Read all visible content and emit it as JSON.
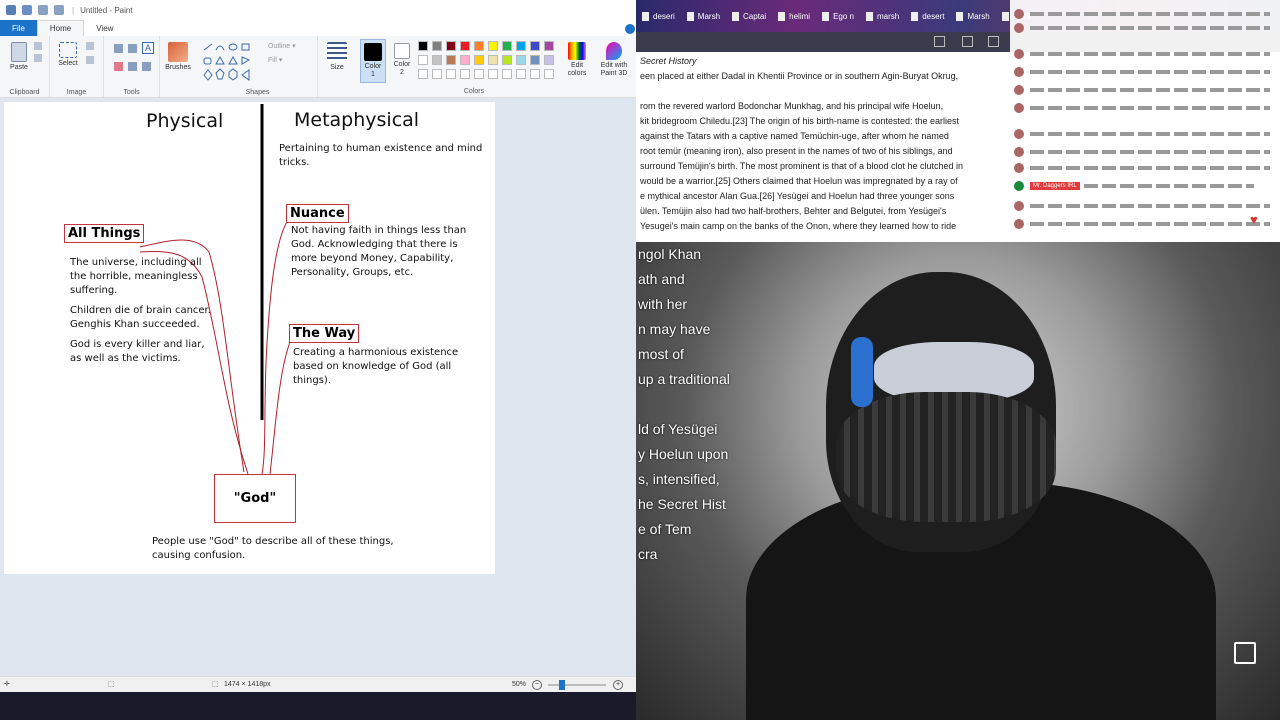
{
  "paint": {
    "title": "Untitled - Paint",
    "tabs": [
      "File",
      "Home",
      "View"
    ],
    "groups": {
      "clipboard": "Clipboard",
      "image": "Image",
      "tools": "Tools",
      "shapes": "Shapes",
      "colors": "Colors"
    },
    "buttons": {
      "paste": "Paste",
      "select": "Select",
      "brushes": "Brushes",
      "outline": "Outline",
      "fill": "Fill",
      "size": "Size",
      "color1_a": "Color",
      "color1_b": "1",
      "color2_a": "Color",
      "color2_b": "2",
      "edit_colors_a": "Edit",
      "edit_colors_b": "colors",
      "paint3d_a": "Edit with",
      "paint3d_b": "Paint 3D"
    },
    "palette": [
      "#000000",
      "#7f7f7f",
      "#880015",
      "#ed1c24",
      "#ff7f27",
      "#fff200",
      "#22b14c",
      "#00a2e8",
      "#3f48cc",
      "#a349a4",
      "#ffffff",
      "#c3c3c3",
      "#b97a57",
      "#ffaec9",
      "#ffc90e",
      "#efe4b0",
      "#b5e61d",
      "#99d9ea",
      "#7092be",
      "#c8bfe7"
    ],
    "status": {
      "dimensions": "1474 × 1418px",
      "zoom": "50%"
    }
  },
  "drawing": {
    "col_physical": "Physical",
    "col_metaphysical": "Metaphysical",
    "metaphysical_desc": [
      "Pertaining to human existence and mind",
      "tricks."
    ],
    "all_things": {
      "label": "All Things",
      "lines": [
        "The universe, including all",
        "the horrible, meaningless",
        "suffering.",
        "",
        "Children die of brain cancer.",
        "Genghis Khan succeeded.",
        "",
        "God is every killer and liar,",
        "as well as the victims."
      ]
    },
    "nuance": {
      "label": "Nuance",
      "lines": [
        "Not having faith in things less than",
        "God. Acknowledging that there is",
        "more beyond Money, Capability,",
        "Personality, Groups, etc."
      ]
    },
    "the_way": {
      "label": "The Way",
      "lines": [
        "Creating a harmonious existence",
        "based on knowledge of God (all",
        "things)."
      ]
    },
    "god": {
      "label": "\"God\""
    },
    "footer": [
      "People use \"God\" to describe all of these things,",
      "causing confusion."
    ]
  },
  "browser": {
    "tabs": [
      "deseri",
      "Marsh",
      "Captai",
      "helimi",
      "Ego n",
      "marsh",
      "desert",
      "Marsh",
      "2019"
    ],
    "article_lines": [
      {
        "t": "Secret History",
        "i": true
      },
      {
        "t": "een placed at either Dadal in Khentii Province or in southern Agin-Buryat Okrug,"
      },
      {
        "t": ""
      },
      {
        "t": "rom the revered warlord Bodonchar Munkhag, and his principal wife Hoelun,"
      },
      {
        "t": "kit bridegroom Chiledu.[23] The origin of his birth-name is contested: the earliest"
      },
      {
        "t": "against the Tatars with a captive named Temüchin-uge, after whom he named"
      },
      {
        "t": "root temür (meaning iron), also present in the names of two of his siblings, and"
      },
      {
        "t": "surround Temüjin's birth. The most prominent is that of a blood clot he clutched in"
      },
      {
        "t": "would be a warrior.[25] Others claimed that Hoelun was impregnated by a ray of"
      },
      {
        "t": "e mythical ancestor Alan Gua.[26] Yesügei and Hoelun had three younger sons"
      },
      {
        "t": "ülen. Temüjin also had two half-brothers, Behter and Belgutei, from Yesügei's"
      },
      {
        "t": "Yesugei's main camp on the banks of the Onon, where they learned how to ride"
      }
    ],
    "chat": {
      "badge": "Mr. Daggers IRL"
    },
    "video_text": [
      "ngol Khan",
      "ath and",
      "with her",
      "n may have",
      "most of",
      "up a traditional",
      "",
      "ld of Yesügei",
      "y Hoelun upon",
      "s, intensified,",
      "he Secret Hist",
      "e of Tem",
      "cra"
    ]
  }
}
